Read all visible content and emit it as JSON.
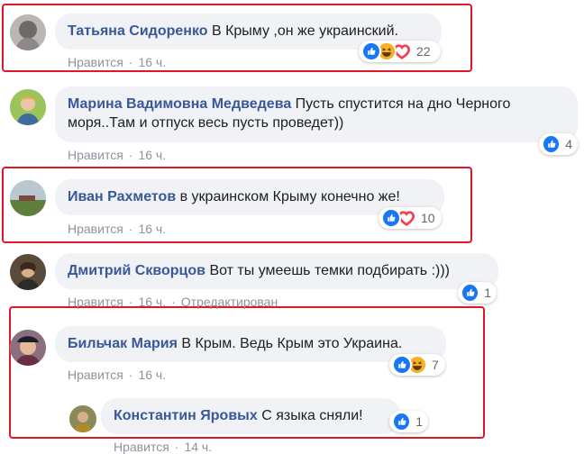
{
  "comments": [
    {
      "author": "Татьяна Сидоренко",
      "text": "В Крыму ,он же украинский.",
      "like_label": "Нравится",
      "time": "16 ч.",
      "reaction_count": "22",
      "reactions": [
        "like-icon",
        "haha-icon",
        "love-icon"
      ]
    },
    {
      "author": "Марина Вадимовна Медведева",
      "text_line1": "Пусть спустится на дно Черного",
      "text_line2": "моря..Там и отпуск весь пусть проведет))",
      "like_label": "Нравится",
      "time": "16 ч.",
      "reaction_count": "4",
      "reactions": [
        "like-icon"
      ]
    },
    {
      "author": "Иван Рахметов",
      "text": "в украинском Крыму конечно же!",
      "like_label": "Нравится",
      "time": "16 ч.",
      "reaction_count": "10",
      "reactions": [
        "like-icon",
        "love-icon"
      ]
    },
    {
      "author": "Дмитрий Скворцов",
      "text": "Вот ты умеешь темки подбирать :)))",
      "like_label": "Нравится",
      "time": "16 ч.",
      "edited": "Отредактирован",
      "reaction_count": "1",
      "reactions": [
        "like-icon"
      ]
    },
    {
      "author": "Бильчак Мария",
      "text": "В Крым. Ведь Крым это Украина.",
      "like_label": "Нравится",
      "time": "16 ч.",
      "reaction_count": "7",
      "reactions": [
        "like-icon",
        "haha-icon"
      ]
    },
    {
      "author": "Константин Яровых",
      "text": "С языка сняли!",
      "like_label": "Нравится",
      "time": "14 ч.",
      "reaction_count": "1",
      "reactions": [
        "like-icon"
      ]
    }
  ],
  "colors": {
    "author": "#385898",
    "bubble": "#f0f2f5",
    "meta": "#8d949e",
    "highlight_frame": "#e0162b",
    "like": "#1877f2"
  }
}
